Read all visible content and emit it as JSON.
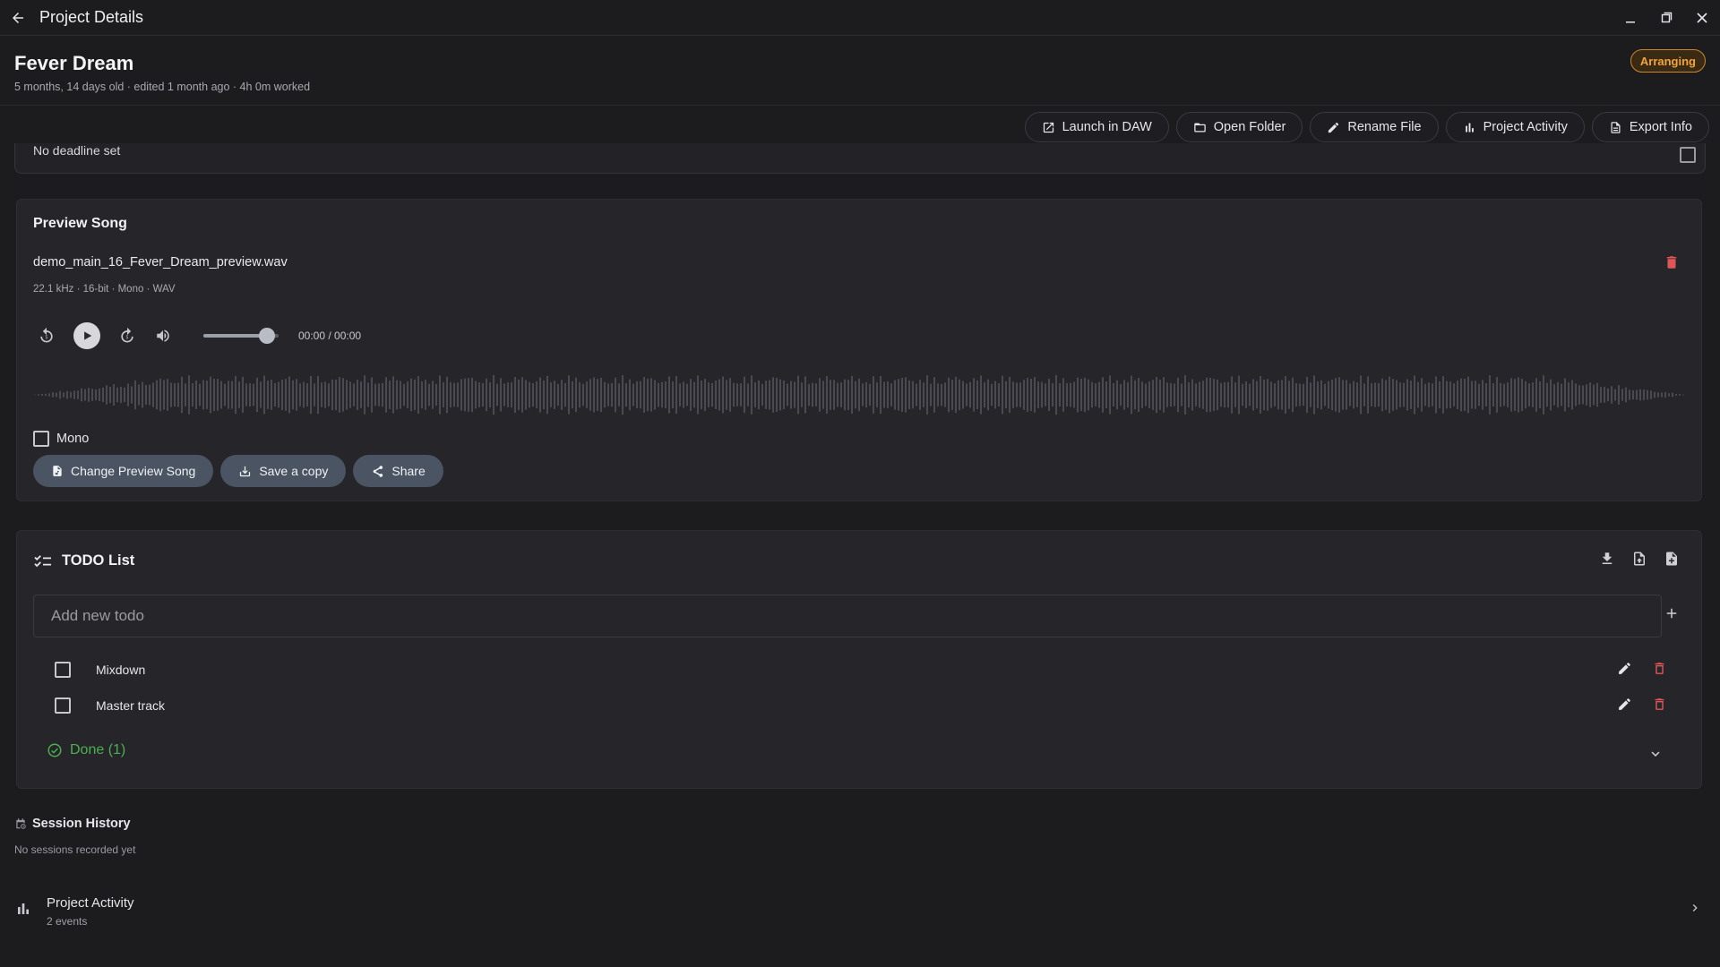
{
  "window": {
    "title": "Project Details"
  },
  "project": {
    "name": "Fever Dream",
    "meta": "5 months, 14 days old · edited 1 month ago · 4h 0m worked",
    "status": "Arranging"
  },
  "toolbar": {
    "launch": "Launch in DAW",
    "open_folder": "Open Folder",
    "rename": "Rename File",
    "activity": "Project Activity",
    "export": "Export Info"
  },
  "deadline": {
    "text": "No deadline set"
  },
  "preview": {
    "title": "Preview Song",
    "file_name": "demo_main_16_Fever_Dream_preview.wav",
    "file_info": "22.1 kHz · 16-bit · Mono · WAV",
    "time": "00:00 / 00:00",
    "volume": 0.85,
    "mono_label": "Mono",
    "change_btn": "Change Preview Song",
    "save_btn": "Save a copy",
    "share_btn": "Share"
  },
  "todo": {
    "title": "TODO List",
    "placeholder": "Add new todo",
    "items": [
      {
        "label": "Mixdown"
      },
      {
        "label": "Master track"
      }
    ],
    "done_label": "Done (1)"
  },
  "session": {
    "title": "Session History",
    "empty": "No sessions recorded yet"
  },
  "activity": {
    "title": "Project Activity",
    "count": "2 events"
  },
  "colors": {
    "background": "#1c1c1f",
    "card": "#26262a",
    "status_accent": "#f0a53e",
    "delete_red": "#e05555",
    "done_green": "#4caf50",
    "pill_button": "#4a5462"
  }
}
